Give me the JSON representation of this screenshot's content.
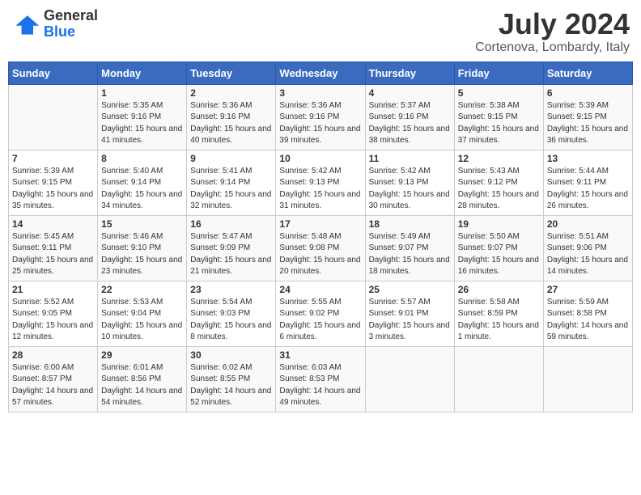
{
  "header": {
    "logo_line1": "General",
    "logo_line2": "Blue",
    "month_year": "July 2024",
    "location": "Cortenova, Lombardy, Italy"
  },
  "days_of_week": [
    "Sunday",
    "Monday",
    "Tuesday",
    "Wednesday",
    "Thursday",
    "Friday",
    "Saturday"
  ],
  "weeks": [
    [
      {
        "day": "",
        "sunrise": "",
        "sunset": "",
        "daylight": ""
      },
      {
        "day": "1",
        "sunrise": "Sunrise: 5:35 AM",
        "sunset": "Sunset: 9:16 PM",
        "daylight": "Daylight: 15 hours and 41 minutes."
      },
      {
        "day": "2",
        "sunrise": "Sunrise: 5:36 AM",
        "sunset": "Sunset: 9:16 PM",
        "daylight": "Daylight: 15 hours and 40 minutes."
      },
      {
        "day": "3",
        "sunrise": "Sunrise: 5:36 AM",
        "sunset": "Sunset: 9:16 PM",
        "daylight": "Daylight: 15 hours and 39 minutes."
      },
      {
        "day": "4",
        "sunrise": "Sunrise: 5:37 AM",
        "sunset": "Sunset: 9:16 PM",
        "daylight": "Daylight: 15 hours and 38 minutes."
      },
      {
        "day": "5",
        "sunrise": "Sunrise: 5:38 AM",
        "sunset": "Sunset: 9:15 PM",
        "daylight": "Daylight: 15 hours and 37 minutes."
      },
      {
        "day": "6",
        "sunrise": "Sunrise: 5:39 AM",
        "sunset": "Sunset: 9:15 PM",
        "daylight": "Daylight: 15 hours and 36 minutes."
      }
    ],
    [
      {
        "day": "7",
        "sunrise": "Sunrise: 5:39 AM",
        "sunset": "Sunset: 9:15 PM",
        "daylight": "Daylight: 15 hours and 35 minutes."
      },
      {
        "day": "8",
        "sunrise": "Sunrise: 5:40 AM",
        "sunset": "Sunset: 9:14 PM",
        "daylight": "Daylight: 15 hours and 34 minutes."
      },
      {
        "day": "9",
        "sunrise": "Sunrise: 5:41 AM",
        "sunset": "Sunset: 9:14 PM",
        "daylight": "Daylight: 15 hours and 32 minutes."
      },
      {
        "day": "10",
        "sunrise": "Sunrise: 5:42 AM",
        "sunset": "Sunset: 9:13 PM",
        "daylight": "Daylight: 15 hours and 31 minutes."
      },
      {
        "day": "11",
        "sunrise": "Sunrise: 5:42 AM",
        "sunset": "Sunset: 9:13 PM",
        "daylight": "Daylight: 15 hours and 30 minutes."
      },
      {
        "day": "12",
        "sunrise": "Sunrise: 5:43 AM",
        "sunset": "Sunset: 9:12 PM",
        "daylight": "Daylight: 15 hours and 28 minutes."
      },
      {
        "day": "13",
        "sunrise": "Sunrise: 5:44 AM",
        "sunset": "Sunset: 9:11 PM",
        "daylight": "Daylight: 15 hours and 26 minutes."
      }
    ],
    [
      {
        "day": "14",
        "sunrise": "Sunrise: 5:45 AM",
        "sunset": "Sunset: 9:11 PM",
        "daylight": "Daylight: 15 hours and 25 minutes."
      },
      {
        "day": "15",
        "sunrise": "Sunrise: 5:46 AM",
        "sunset": "Sunset: 9:10 PM",
        "daylight": "Daylight: 15 hours and 23 minutes."
      },
      {
        "day": "16",
        "sunrise": "Sunrise: 5:47 AM",
        "sunset": "Sunset: 9:09 PM",
        "daylight": "Daylight: 15 hours and 21 minutes."
      },
      {
        "day": "17",
        "sunrise": "Sunrise: 5:48 AM",
        "sunset": "Sunset: 9:08 PM",
        "daylight": "Daylight: 15 hours and 20 minutes."
      },
      {
        "day": "18",
        "sunrise": "Sunrise: 5:49 AM",
        "sunset": "Sunset: 9:07 PM",
        "daylight": "Daylight: 15 hours and 18 minutes."
      },
      {
        "day": "19",
        "sunrise": "Sunrise: 5:50 AM",
        "sunset": "Sunset: 9:07 PM",
        "daylight": "Daylight: 15 hours and 16 minutes."
      },
      {
        "day": "20",
        "sunrise": "Sunrise: 5:51 AM",
        "sunset": "Sunset: 9:06 PM",
        "daylight": "Daylight: 15 hours and 14 minutes."
      }
    ],
    [
      {
        "day": "21",
        "sunrise": "Sunrise: 5:52 AM",
        "sunset": "Sunset: 9:05 PM",
        "daylight": "Daylight: 15 hours and 12 minutes."
      },
      {
        "day": "22",
        "sunrise": "Sunrise: 5:53 AM",
        "sunset": "Sunset: 9:04 PM",
        "daylight": "Daylight: 15 hours and 10 minutes."
      },
      {
        "day": "23",
        "sunrise": "Sunrise: 5:54 AM",
        "sunset": "Sunset: 9:03 PM",
        "daylight": "Daylight: 15 hours and 8 minutes."
      },
      {
        "day": "24",
        "sunrise": "Sunrise: 5:55 AM",
        "sunset": "Sunset: 9:02 PM",
        "daylight": "Daylight: 15 hours and 6 minutes."
      },
      {
        "day": "25",
        "sunrise": "Sunrise: 5:57 AM",
        "sunset": "Sunset: 9:01 PM",
        "daylight": "Daylight: 15 hours and 3 minutes."
      },
      {
        "day": "26",
        "sunrise": "Sunrise: 5:58 AM",
        "sunset": "Sunset: 8:59 PM",
        "daylight": "Daylight: 15 hours and 1 minute."
      },
      {
        "day": "27",
        "sunrise": "Sunrise: 5:59 AM",
        "sunset": "Sunset: 8:58 PM",
        "daylight": "Daylight: 14 hours and 59 minutes."
      }
    ],
    [
      {
        "day": "28",
        "sunrise": "Sunrise: 6:00 AM",
        "sunset": "Sunset: 8:57 PM",
        "daylight": "Daylight: 14 hours and 57 minutes."
      },
      {
        "day": "29",
        "sunrise": "Sunrise: 6:01 AM",
        "sunset": "Sunset: 8:56 PM",
        "daylight": "Daylight: 14 hours and 54 minutes."
      },
      {
        "day": "30",
        "sunrise": "Sunrise: 6:02 AM",
        "sunset": "Sunset: 8:55 PM",
        "daylight": "Daylight: 14 hours and 52 minutes."
      },
      {
        "day": "31",
        "sunrise": "Sunrise: 6:03 AM",
        "sunset": "Sunset: 8:53 PM",
        "daylight": "Daylight: 14 hours and 49 minutes."
      },
      {
        "day": "",
        "sunrise": "",
        "sunset": "",
        "daylight": ""
      },
      {
        "day": "",
        "sunrise": "",
        "sunset": "",
        "daylight": ""
      },
      {
        "day": "",
        "sunrise": "",
        "sunset": "",
        "daylight": ""
      }
    ]
  ]
}
